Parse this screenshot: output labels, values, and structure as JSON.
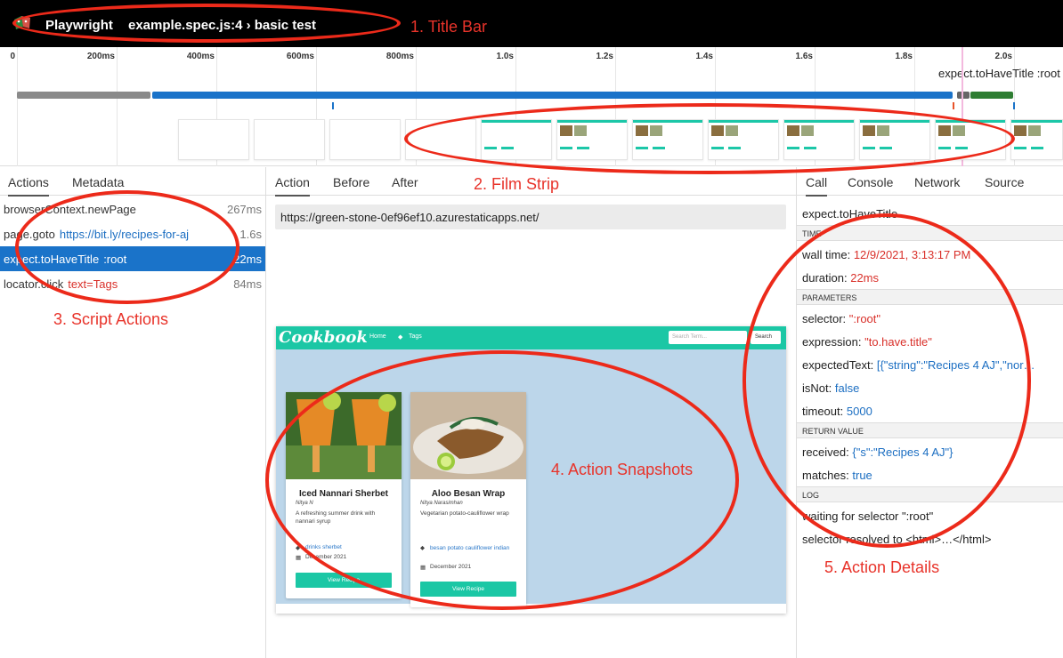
{
  "titlebar": {
    "app_name": "Playwright",
    "test_name": "example.spec.js:4 › basic test"
  },
  "timeline": {
    "ticks": [
      "0",
      "200ms",
      "400ms",
      "600ms",
      "800ms",
      "1.0s",
      "1.2s",
      "1.4s",
      "1.6s",
      "1.8s",
      "2.0s"
    ],
    "hover_label": "expect.toHaveTitle :root"
  },
  "actions_panel": {
    "tabs": [
      "Actions",
      "Metadata"
    ],
    "items": [
      {
        "name": "browserContext.newPage",
        "param": "",
        "duration": "267ms"
      },
      {
        "name": "page.goto",
        "param": "https://bit.ly/recipes-for-aj",
        "duration": "1.6s"
      },
      {
        "name": "expect.toHaveTitle",
        "param": ":root",
        "duration": "22ms"
      },
      {
        "name": "locator.click",
        "param": "text=Tags",
        "duration": "84ms"
      }
    ]
  },
  "snapshot_panel": {
    "tabs": [
      "Action",
      "Before",
      "After"
    ],
    "url": "https://green-stone-0ef96ef10.azurestaticapps.net/",
    "page": {
      "brand": "Cookbook",
      "nav_home": "Home",
      "nav_tags": "Tags",
      "search_placeholder": "Search Term...",
      "search_button": "Search",
      "cards": [
        {
          "title": "Iced Nannari Sherbet",
          "author": "Nitya N",
          "description": "A refreshing summer drink with nannari syrup",
          "tags": "drinks sherbet",
          "date": "December 2021",
          "button": "View Recipe"
        },
        {
          "title": "Aloo Besan Wrap",
          "author": "Nitya Narasimhan",
          "description": "Vegetarian potato-cauliflower wrap",
          "tags": "besan potato cauliflower indian",
          "date": "December 2021",
          "button": "View Recipe"
        }
      ]
    }
  },
  "details_panel": {
    "tabs": [
      "Call",
      "Console",
      "Network",
      "Source"
    ],
    "call_name": "expect.toHaveTitle",
    "sections": {
      "time": "TIME",
      "parameters": "PARAMETERS",
      "return_value": "RETURN VALUE",
      "log": "LOG"
    },
    "wall_time_label": "wall time:",
    "wall_time": "12/9/2021, 3:13:17 PM",
    "duration_label": "duration:",
    "duration": "22ms",
    "selector_label": "selector:",
    "selector": "\":root\"",
    "expression_label": "expression:",
    "expression": "\"to.have.title\"",
    "expected_label": "expectedText:",
    "expected": "[{\"string\":\"Recipes 4 AJ\",\"nor…",
    "isnot_label": "isNot:",
    "isnot": "false",
    "timeout_label": "timeout:",
    "timeout": "5000",
    "received_label": "received:",
    "received": "{\"s\":\"Recipes 4 AJ\"}",
    "matches_label": "matches:",
    "matches": "true",
    "log": [
      "waiting for selector \":root\"",
      "selector resolved to <html>…</html>"
    ]
  },
  "annotations": {
    "title_bar": "1. Title Bar",
    "film_strip": "2. Film Strip",
    "script_actions": "3. Script Actions",
    "action_snapshots": "4. Action Snapshots",
    "action_details": "5. Action Details"
  },
  "colors": {
    "annotation": "#ec2a1a",
    "selection": "#1a73c9",
    "accent": "#1bc7a5"
  }
}
